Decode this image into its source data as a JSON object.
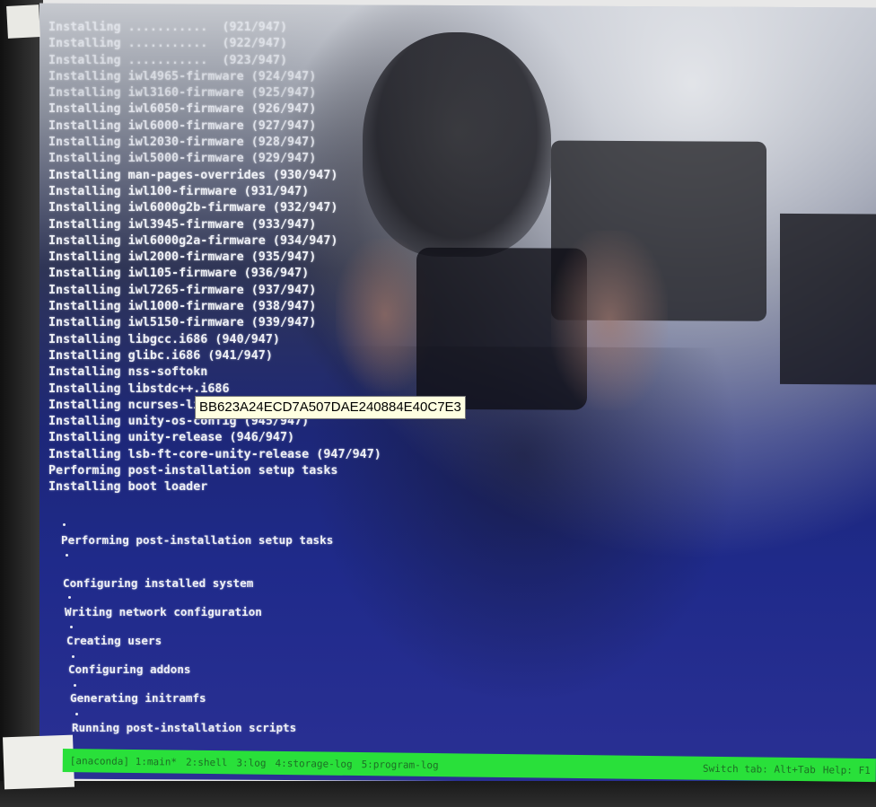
{
  "terminal": {
    "install_lines": [
      "Installing iwl4965-firmware (924/947)",
      "Installing iwl3160-firmware (925/947)",
      "Installing iwl6050-firmware (926/947)",
      "Installing iwl6000-firmware (927/947)",
      "Installing iwl2030-firmware (928/947)",
      "Installing iwl5000-firmware (929/947)",
      "Installing man-pages-overrides (930/947)",
      "Installing iwl100-firmware (931/947)",
      "Installing iwl6000g2b-firmware (932/947)",
      "Installing iwl3945-firmware (933/947)",
      "Installing iwl6000g2a-firmware (934/947)",
      "Installing iwl2000-firmware (935/947)",
      "Installing iwl105-firmware (936/947)",
      "Installing iwl7265-firmware (937/947)",
      "Installing iwl1000-firmware (938/947)",
      "Installing iwl5150-firmware (939/947)",
      "Installing libgcc.i686 (940/947)",
      "Installing glibc.i686 (941/947)",
      "Installing nss-softokn",
      "Installing libstdc++.i686",
      "Installing ncurses-libs.i686 (944/947)",
      "Installing unity-os-config (945/947)",
      "Installing unity-release (946/947)",
      "Installing lsb-ft-core-unity-release (947/947)",
      "Performing post-installation setup tasks",
      "Installing boot loader"
    ],
    "post_lines": [
      "Performing post-installation setup tasks",
      "Configuring installed system",
      "Writing network configuration",
      "Creating users",
      "Configuring addons",
      "Generating initramfs",
      "Running post-installation scripts"
    ]
  },
  "statusbar": {
    "tabs": [
      "[anaconda] 1:main*",
      "2:shell",
      "3:log",
      "4:storage-log",
      "5:program-log"
    ],
    "hints": [
      "Switch tab: Alt+Tab",
      "Help: F1"
    ]
  },
  "tooltip": {
    "text": "BB623A24ECD7A507DAE240884E40C7E3"
  },
  "colors": {
    "statusbar": "#29e03a",
    "screen_blue": "#1f2a8a",
    "tooltip_bg": "#ffffe1"
  }
}
